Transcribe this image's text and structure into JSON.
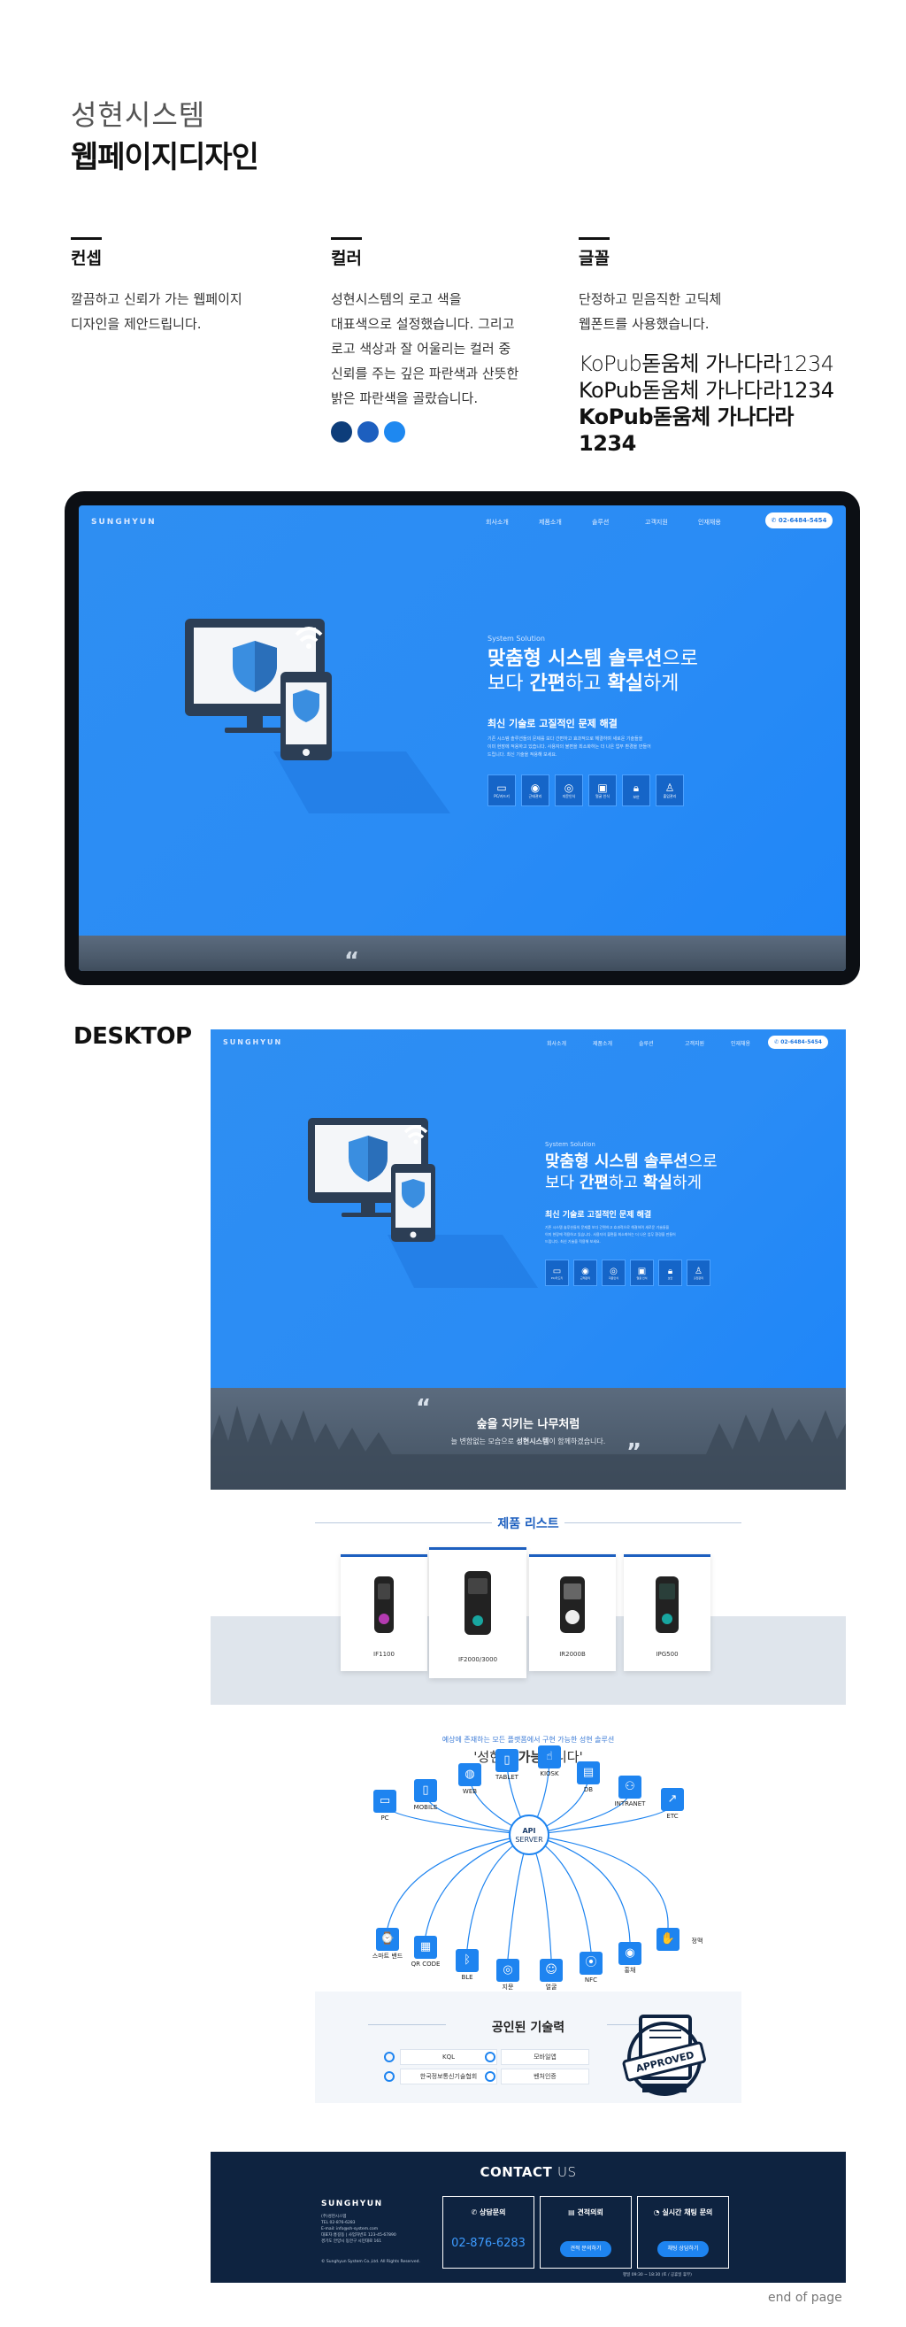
{
  "header": {
    "company": "성현시스템",
    "project": "웹페이지디자인"
  },
  "concept": {
    "title": "컨셉",
    "lines": [
      "깔끔하고 신뢰가 가는 웹페이지",
      "디자인을 제안드립니다."
    ]
  },
  "color": {
    "title": "컬러",
    "lines": [
      "성현시스템의 로고 색을",
      "대표색으로 설정했습니다. 그리고",
      "로고 색상과 잘 어울리는 컬러 중",
      "신뢰를 주는 깊은 파란색과 산뜻한",
      "밝은 파란색을 골랐습니다."
    ],
    "swatches": [
      "#0d3d7a",
      "#1d5fbf",
      "#1e88f0"
    ]
  },
  "font": {
    "title": "글꼴",
    "lines": [
      "단정하고 믿음직한 고딕체",
      "웹폰트를 사용했습니다."
    ],
    "samples": [
      "KoPub돋움체  가나다라1234",
      "KoPub돋움체  가나다라1234",
      "KoPub돋움체  가나다라1234"
    ]
  },
  "site": {
    "logo": "SUNGHYUN",
    "nav": [
      "회사소개",
      "제품소개",
      "솔루션",
      "고객지원",
      "인재채용"
    ],
    "phone": "02-6484-5454",
    "hero_kicker": "System Solution",
    "hero_line1_bold": "맞춤형 시스템 솔루션",
    "hero_line1_rest": "으로",
    "hero_line2_a": "보다 ",
    "hero_line2_b": "간편",
    "hero_line2_c": "하고 ",
    "hero_line2_d": "확실",
    "hero_line2_e": "하게",
    "hero_sub_a": "최신 기술로 ",
    "hero_sub_b": "고질적인 문제 해결",
    "hero_desc": [
      "기존 시스템 솔루션들의 문제를 보다 간편하고 효과적으로 해결하며 새로운 기술들을",
      "이미 현장에 적용하고 있습니다. 사용자의 불편을 최소화하는 더 나은 업무 환경을 만들어",
      "드립니다. 최신 기술을 적용해 보세요."
    ],
    "services": [
      "PC/카드키",
      "근태관리",
      "지문인식",
      "얼굴 인식",
      "보안",
      "출입관리"
    ],
    "quote_title": "숲을 지키는 나무처럼",
    "quote_a": "늘 변함없는 모습으로 ",
    "quote_b": "성현시스템",
    "quote_c": "이 함께하겠습니다."
  },
  "desktop_label": "DESKTOP",
  "products": {
    "title": "제품 리스트",
    "items": [
      "IF1100",
      "IF2000/3000",
      "IR2000B",
      "IPG500"
    ]
  },
  "network": {
    "kicker": "예상에 존재하는 모든 플랫폼에서 구현 가능한 성현 솔루션",
    "title_a": "'성현은 ",
    "title_b": "가능",
    "title_c": "합니다'",
    "api_a": "API",
    "api_b": "SERVER",
    "top_nodes": [
      "PC",
      "MOBILE",
      "WEB",
      "TABLET",
      "KIOSK",
      "DB",
      "INTRANET",
      "ETC"
    ],
    "bottom_nodes": [
      "스마트 밴드",
      "QR CODE",
      "BLE",
      "지문",
      "얼굴",
      "NFC",
      "홍채",
      "정맥"
    ]
  },
  "certs": {
    "title": "공인된 기술력",
    "items": [
      "KQL",
      "모바일앱",
      "한국정보통신기술협회",
      "벤처인증"
    ],
    "stamp": "APPROVED"
  },
  "contact": {
    "title_a": "CONTACT ",
    "title_b": "US",
    "logo": "SUNGHYUN",
    "address": [
      "(주)성현시스템",
      "TEL 02-876-6283",
      "E-mail: info@sh-system.com",
      "대표자:홍길동 | 사업자번호 123-45-67890",
      "경기도 안양시 동안구 시민대로 161"
    ],
    "copyright": "© Sunghyun System Co.,Ltd. All Rights Reserved.",
    "boxes": [
      {
        "title": "상담문의",
        "value": "02-876-6283"
      },
      {
        "title": "견적의뢰",
        "button": "견적 문의하기"
      },
      {
        "title": "실시간 채팅 문의",
        "button": "채팅 상담하기"
      }
    ],
    "hours": "평일 09:30 ~ 18:30 (토 / 공휴일 휴무)"
  },
  "footer_note": "end of page"
}
